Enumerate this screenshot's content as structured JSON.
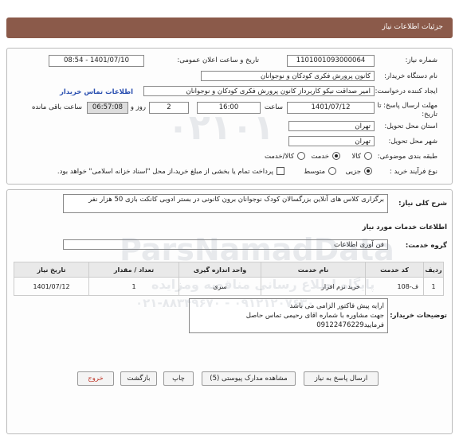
{
  "header": {
    "title": "جزئیات اطلاعات نیاز"
  },
  "form": {
    "need_number_label": "شماره نیاز:",
    "need_number": "1101001093000064",
    "announce_label": "تاریخ و ساعت اعلان عمومی:",
    "announce_value": "1401/07/10 - 08:54",
    "buyer_org_label": "نام دستگاه خریدار:",
    "buyer_org": "کانون پرورش فکری کودکان و نوجوانان",
    "creator_label": "ایجاد کننده درخواست:",
    "creator": "امیر صداقت نیکو کاربرداز کانون پرورش فکری کودکان و نوجوانان",
    "contact_link": "اطلاعات تماس خریدار",
    "deadline_label": "مهلت ارسال پاسخ: تا",
    "deadline_label2": "تاریخ:",
    "deadline_date": "1401/07/12",
    "time_label": "ساعت",
    "deadline_time": "16:00",
    "days": "2",
    "days_label": "روز و",
    "remaining": "06:57:08",
    "remaining_label": "ساعت باقی مانده",
    "province_label": "استان محل تحویل:",
    "province": "تهران",
    "city_label": "شهر محل تحویل:",
    "city": "تهران",
    "category_label": "طبقه بندی موضوعی:",
    "category_options": [
      "کالا",
      "خدمت",
      "کالا/خدمت"
    ],
    "category_selected": "خدمت",
    "process_label": "نوع فرآیند خرید :",
    "process_options": [
      "جزیی",
      "متوسط"
    ],
    "process_selected": "جزیی",
    "payment_note": "پرداخت تمام یا بخشی از مبلغ خرید،از محل \"اسناد خزانه اسلامی\" خواهد بود."
  },
  "detail": {
    "summary_label": "شرح کلی نیاز:",
    "summary": "برگزاری کلاس های آنلاین بزرگسالان کودک نوجوانان برون کانونی در بستر ادوبی کانکت بازی 50 هزار نفر",
    "services_heading": "اطلاعات خدمات مورد نیاز",
    "group_label": "گروه خدمت:",
    "group_value": "فن آوری اطلاعات",
    "table_headers": [
      "ردیف",
      "کد خدمت",
      "نام خدمت",
      "واحد اندازه گیری",
      "تعداد / مقدار",
      "تاریخ نیاز"
    ],
    "rows": [
      [
        "1",
        "ف-108",
        "خرید نرم افزار",
        "سری",
        "1",
        "1401/07/12"
      ]
    ],
    "buyer_notes_label": "توضیحات خریدار:",
    "buyer_notes_line1": "ارایه پیش فاکتور الزامی می باشد",
    "buyer_notes_line2": "جهت مشاوره با شماره  اقای رحیمی تماس حاصل فرمایید09122476229"
  },
  "buttons": {
    "reply": "ارسال پاسخ به نیاز",
    "attachments": "مشاهده مدارک پیوستی (5)",
    "print": "چاپ",
    "back": "بازگشت",
    "exit": "خروج"
  },
  "watermark": {
    "brand": "ParsNamadData",
    "subtitle": "پایگاه اطلاع رسانی مناقصه ومزایده",
    "phone": "۰۲۱-۸۸۳۴۹۶۷۰ - ۰۹۱۲۱۲۰۷۶۳۰",
    "number": "۰۲۱۰۱"
  },
  "colors": {
    "header_bg": "#8b5a4a",
    "link": "#2a4fb0",
    "exit": "#c0392b"
  }
}
